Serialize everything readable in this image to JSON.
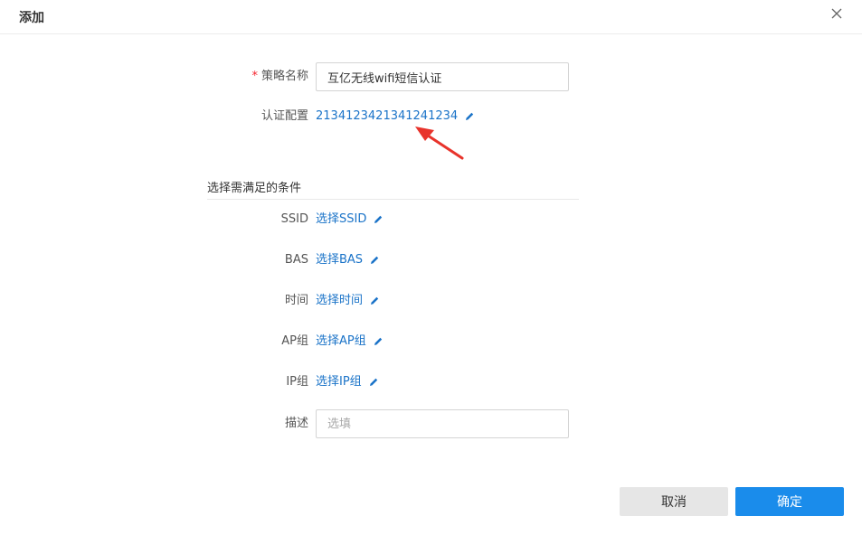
{
  "dialog": {
    "title": "添加",
    "close_icon": "close-icon"
  },
  "form": {
    "policy_name": {
      "required_mark": "*",
      "label": "策略名称",
      "value": "互亿无线wifi短信认证"
    },
    "auth_config": {
      "label": "认证配置",
      "link": "2134123421341241234"
    },
    "conditions_title": "选择需满足的条件",
    "ssid": {
      "label": "SSID",
      "link": "选择SSID"
    },
    "bas": {
      "label": "BAS",
      "link": "选择BAS"
    },
    "time": {
      "label": "时间",
      "link": "选择时间"
    },
    "ap_group": {
      "label": "AP组",
      "link": "选择AP组"
    },
    "ip_group": {
      "label": "IP组",
      "link": "选择IP组"
    },
    "description": {
      "label": "描述",
      "placeholder": "选填"
    }
  },
  "buttons": {
    "cancel": "取消",
    "confirm": "确定"
  },
  "colors": {
    "link": "#1a73c8",
    "primary": "#1a8ceb",
    "annotation_arrow": "#e8332b",
    "required": "#f5222d"
  }
}
